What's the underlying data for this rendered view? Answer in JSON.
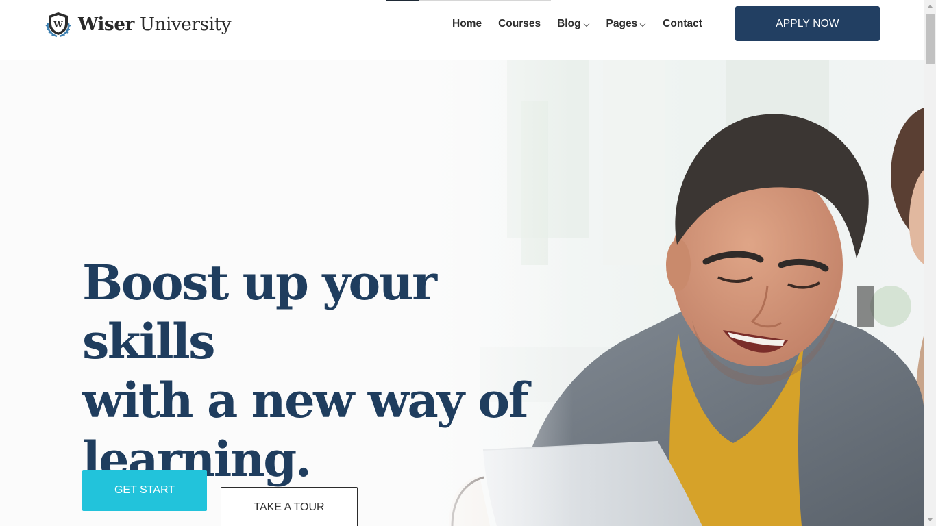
{
  "brand": {
    "name_bold": "Wiser",
    "name_light": "University",
    "logo_icon": "shield-laurel-icon",
    "logo_letter": "W"
  },
  "nav": {
    "items": [
      {
        "label": "Home",
        "has_dropdown": false
      },
      {
        "label": "Courses",
        "has_dropdown": false
      },
      {
        "label": "Blog",
        "has_dropdown": true
      },
      {
        "label": "Pages",
        "has_dropdown": true
      },
      {
        "label": "Contact",
        "has_dropdown": false
      }
    ],
    "apply_label": "APPLY NOW"
  },
  "hero": {
    "heading_lines": [
      "Boost up your skills",
      "with a new way of",
      "learning."
    ],
    "primary_label": "GET START",
    "secondary_label": "TAKE A TOUR",
    "image": "student-smiling-at-laptop-photo"
  },
  "colors": {
    "navy": "#223f62",
    "heading": "#1f3d5e",
    "cyan": "#22c3db",
    "sweater": "#6f7780",
    "shirt": "#d8a326"
  }
}
